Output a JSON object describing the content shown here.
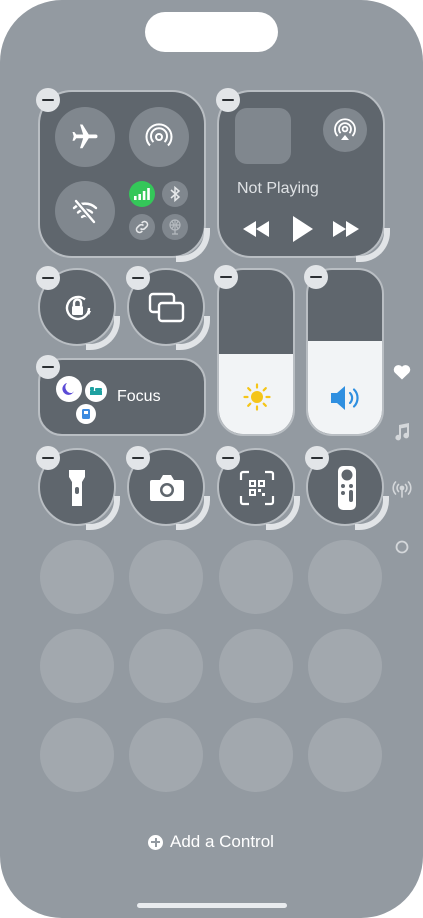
{
  "now_playing": {
    "status": "Not Playing"
  },
  "focus": {
    "label": "Focus"
  },
  "brightness": {
    "level": 0.49
  },
  "volume": {
    "level": 0.57
  },
  "add_control": {
    "label": "Add a Control"
  },
  "pages": [
    {
      "icon": "heart-icon",
      "active": true
    },
    {
      "icon": "music-note-icon",
      "active": false
    },
    {
      "icon": "antenna-icon",
      "active": false
    },
    {
      "icon": "circle-icon",
      "active": false
    }
  ],
  "colors": {
    "background": "#939aa1",
    "module": "#5f666d",
    "cellular_on": "#34c759",
    "volume_blue": "#2f8fe0",
    "brightness_yellow": "#f5c518"
  }
}
